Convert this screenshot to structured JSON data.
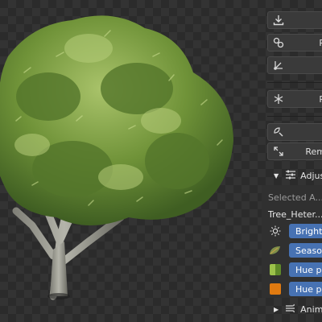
{
  "toolbar": {
    "buttons": [
      {
        "icon": "import-icon",
        "label": ""
      },
      {
        "icon": "link-icon",
        "label": "R"
      },
      {
        "icon": "transform-icon",
        "label": ""
      },
      {
        "icon": "asterisk-icon",
        "label": "R"
      },
      {
        "icon": "leaf-search-icon",
        "label": ""
      },
      {
        "icon": "scale-arrows-icon",
        "label": "Rem"
      }
    ]
  },
  "adjust_panel": {
    "title": "Adjus",
    "selected_label": "Selected A...",
    "object_name": "Tree_Heter...",
    "rows": [
      {
        "icon": "sun-icon",
        "label": "Brightne"
      },
      {
        "icon": "leaf-icon",
        "label": "Season:"
      },
      {
        "icon": "swatch-green-icon",
        "label": "Hue per"
      },
      {
        "icon": "swatch-orange-icon",
        "label": "Hue per"
      }
    ]
  },
  "animation_panel": {
    "title": "Anim"
  },
  "colors": {
    "slider_blue": "#4772b3",
    "swatch_green": "#7fae3a",
    "swatch_orange": "#e07a10",
    "checker_dark": "#2b2b2b",
    "checker_light": "#333333"
  }
}
